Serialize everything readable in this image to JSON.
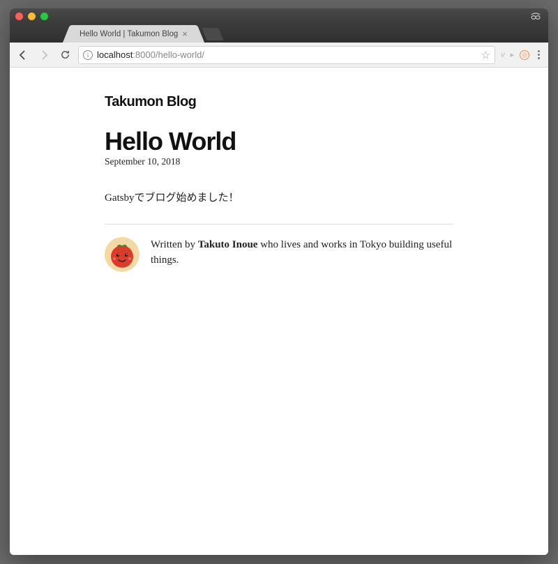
{
  "browser": {
    "tab_title": "Hello World | Takumon Blog",
    "url_host": "localhost",
    "url_port": ":8000",
    "url_path": "/hello-world/"
  },
  "page": {
    "site_title": "Takumon Blog",
    "post_title": "Hello World",
    "post_date": "September 10, 2018",
    "post_body": "Gatsbyでブログ始めました！",
    "bio_prefix": "Written by ",
    "bio_author": "Takuto Inoue",
    "bio_suffix": " who lives and works in Tokyo building useful things."
  },
  "icons": {
    "close_x": "×",
    "info_i": "i",
    "star": "☆",
    "ext_v": "v",
    "ext_arrow": "▸"
  }
}
